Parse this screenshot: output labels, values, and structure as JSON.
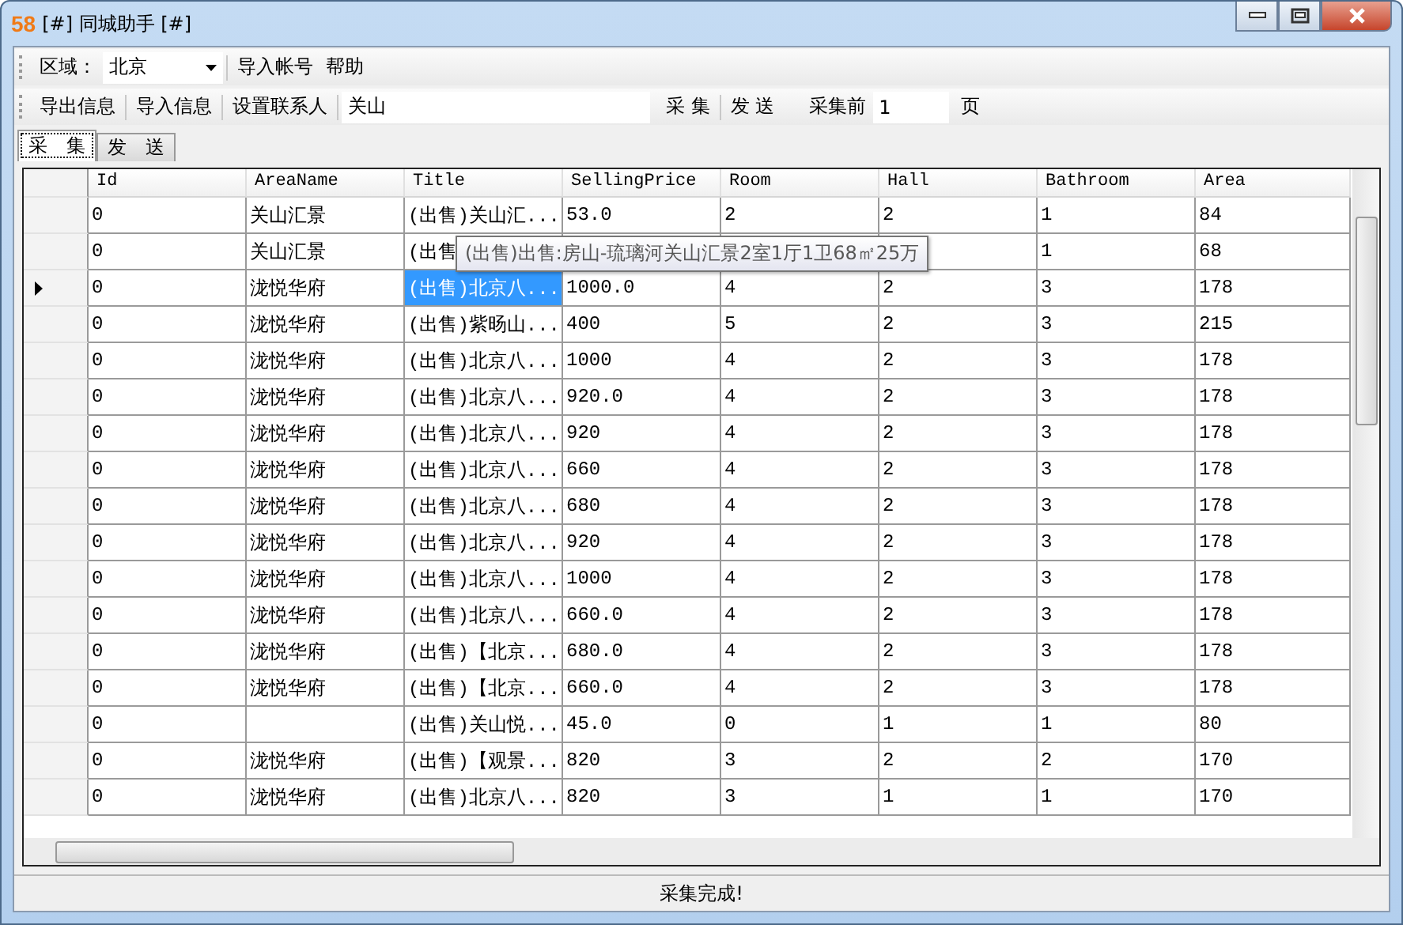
{
  "window": {
    "logo": "58",
    "title": "[#] 同城助手 [#]"
  },
  "toolbar1": {
    "region_label": "区域：",
    "region_value": "北京",
    "items": [
      "导入帐号",
      "帮助"
    ]
  },
  "toolbar2": {
    "items": [
      "导出信息",
      "导入信息",
      "设置联系人"
    ],
    "search_value": "关山",
    "collect": "采 集",
    "send": "发 送",
    "pages_label": "采集前",
    "pages_value": "1",
    "pages_unit": "页"
  },
  "tabs": [
    {
      "label": "采　集",
      "selected": true
    },
    {
      "label": "发　送",
      "selected": false
    }
  ],
  "table": {
    "columns": [
      "Id",
      "AreaName",
      "Title",
      "SellingPrice",
      "Room",
      "Hall",
      "Bathroom",
      "Area"
    ],
    "rows": [
      {
        "selected": false,
        "cells": [
          "0",
          "关山汇景",
          "(出售)关山汇...",
          "53.0",
          "2",
          "2",
          "1",
          "84"
        ]
      },
      {
        "selected": false,
        "cells": [
          "0",
          "关山汇景",
          "(出售",
          null,
          null,
          null,
          "1",
          "68"
        ]
      },
      {
        "selected": true,
        "cells": [
          "0",
          "泷悦华府",
          "(出售)北京八...",
          "1000.0",
          "4",
          "2",
          "3",
          "178"
        ]
      },
      {
        "selected": false,
        "cells": [
          "0",
          "泷悦华府",
          "(出售)紫旸山...",
          "400",
          "5",
          "2",
          "3",
          "215"
        ]
      },
      {
        "selected": false,
        "cells": [
          "0",
          "泷悦华府",
          "(出售)北京八...",
          "1000",
          "4",
          "2",
          "3",
          "178"
        ]
      },
      {
        "selected": false,
        "cells": [
          "0",
          "泷悦华府",
          "(出售)北京八...",
          "920.0",
          "4",
          "2",
          "3",
          "178"
        ]
      },
      {
        "selected": false,
        "cells": [
          "0",
          "泷悦华府",
          "(出售)北京八...",
          "920",
          "4",
          "2",
          "3",
          "178"
        ]
      },
      {
        "selected": false,
        "cells": [
          "0",
          "泷悦华府",
          "(出售)北京八...",
          "660",
          "4",
          "2",
          "3",
          "178"
        ]
      },
      {
        "selected": false,
        "cells": [
          "0",
          "泷悦华府",
          "(出售)北京八...",
          "680",
          "4",
          "2",
          "3",
          "178"
        ]
      },
      {
        "selected": false,
        "cells": [
          "0",
          "泷悦华府",
          "(出售)北京八...",
          "920",
          "4",
          "2",
          "3",
          "178"
        ]
      },
      {
        "selected": false,
        "cells": [
          "0",
          "泷悦华府",
          "(出售)北京八...",
          "1000",
          "4",
          "2",
          "3",
          "178"
        ]
      },
      {
        "selected": false,
        "cells": [
          "0",
          "泷悦华府",
          "(出售)北京八...",
          "660.0",
          "4",
          "2",
          "3",
          "178"
        ]
      },
      {
        "selected": false,
        "cells": [
          "0",
          "泷悦华府",
          "(出售)【北京...",
          "680.0",
          "4",
          "2",
          "3",
          "178"
        ]
      },
      {
        "selected": false,
        "cells": [
          "0",
          "泷悦华府",
          "(出售)【北京...",
          "660.0",
          "4",
          "2",
          "3",
          "178"
        ]
      },
      {
        "selected": false,
        "cells": [
          "0",
          null,
          "(出售)关山悦...",
          "45.0",
          "0",
          "1",
          "1",
          "80"
        ]
      },
      {
        "selected": false,
        "cells": [
          "0",
          "泷悦华府",
          "(出售)【观景...",
          "820",
          "3",
          "2",
          "2",
          "170"
        ]
      },
      {
        "selected": false,
        "cells": [
          "0",
          "泷悦华府",
          "(出售)北京八...",
          "820",
          "3",
          "1",
          "1",
          "170"
        ]
      }
    ]
  },
  "tooltip": "(出售)出售:房山-琉璃河关山汇景2室1厅1卫68㎡25万",
  "status_bar": "采集完成!"
}
